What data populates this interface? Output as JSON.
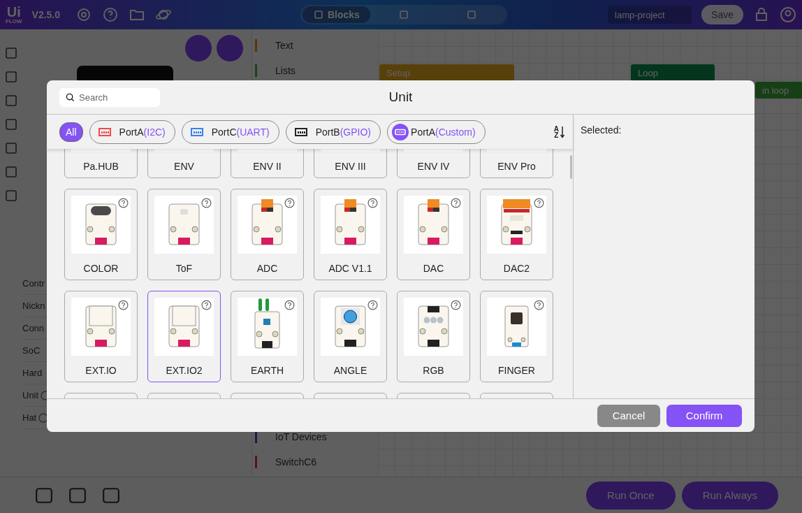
{
  "app": {
    "logo_top": "Ui",
    "logo_bottom": "FLOW",
    "version": "V2.5.0",
    "view_tabs": [
      {
        "label": "Blocks",
        "selected": true
      },
      {
        "selected": false
      },
      {
        "selected": false
      }
    ],
    "project_name": "lamp-project",
    "save": "Save",
    "left_items": [
      {
        "label": "Contr"
      },
      {
        "label": "Nickn"
      },
      {
        "label": "Conn"
      },
      {
        "label": "SoC"
      },
      {
        "label": "Hard"
      },
      {
        "label": "Unit",
        "info": true
      },
      {
        "label": "Hat",
        "info": true
      }
    ],
    "categories_top": [
      "Text",
      "Lists"
    ],
    "categories_bottom": [
      "IoT Devices",
      "SwitchC6"
    ],
    "blocks": [
      "Setup",
      "Loop",
      "in loop"
    ],
    "run_buttons": [
      "Run Once",
      "Run Always"
    ]
  },
  "dialog": {
    "title": "Unit",
    "search": {
      "placeholder": "Search"
    },
    "filters": [
      {
        "label": "All",
        "selected": true,
        "kind": "all",
        "color": "#8452f5"
      },
      {
        "label": "PortA",
        "suffix": "(I2C)",
        "selected": false,
        "kind": "port",
        "color": "#f04848"
      },
      {
        "label": "PortC",
        "suffix": "(UART)",
        "selected": false,
        "kind": "port",
        "color": "#3b7ff0"
      },
      {
        "label": "PortB",
        "suffix": "(GPIO)",
        "selected": false,
        "kind": "port",
        "color": "#222222"
      },
      {
        "label": "PortA",
        "suffix": "(Custom)",
        "selected": false,
        "kind": "custom",
        "color": "#8452f5"
      }
    ],
    "sort": {
      "top": "A",
      "bottom": "Z"
    },
    "units": [
      {
        "name": "Pa.HUB",
        "kind": "cut",
        "selected": false
      },
      {
        "name": "ENV",
        "kind": "cut",
        "selected": false
      },
      {
        "name": "ENV II",
        "kind": "cut",
        "selected": false
      },
      {
        "name": "ENV III",
        "kind": "cut",
        "selected": false
      },
      {
        "name": "ENV IV",
        "kind": "cut",
        "selected": false
      },
      {
        "name": "ENV Pro",
        "kind": "cut",
        "selected": false
      },
      {
        "name": "COLOR",
        "kind": "color",
        "selected": false
      },
      {
        "name": "ToF",
        "kind": "tof",
        "selected": false
      },
      {
        "name": "ADC",
        "kind": "adc",
        "selected": false
      },
      {
        "name": "ADC V1.1",
        "kind": "adc",
        "selected": false
      },
      {
        "name": "DAC",
        "kind": "adc",
        "selected": false
      },
      {
        "name": "DAC2",
        "kind": "dac2",
        "selected": false
      },
      {
        "name": "EXT.IO",
        "kind": "extio",
        "selected": false
      },
      {
        "name": "EXT.IO2",
        "kind": "extio",
        "selected": true
      },
      {
        "name": "EARTH",
        "kind": "earth",
        "selected": false
      },
      {
        "name": "ANGLE",
        "kind": "angle",
        "selected": false
      },
      {
        "name": "RGB",
        "kind": "rgb",
        "selected": false
      },
      {
        "name": "FINGER",
        "kind": "finger",
        "selected": false
      },
      {
        "kind": "cut",
        "selected": false
      },
      {
        "kind": "cut",
        "selected": false
      },
      {
        "kind": "cut",
        "selected": false
      },
      {
        "kind": "cut",
        "selected": false
      },
      {
        "kind": "cut",
        "selected": false
      },
      {
        "kind": "cut",
        "selected": false
      }
    ],
    "selected_label": "Selected:",
    "cancel": "Cancel",
    "confirm": "Confirm"
  }
}
